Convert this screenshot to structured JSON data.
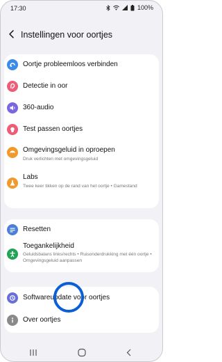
{
  "status": {
    "time": "17:30",
    "battery": "100%"
  },
  "header": {
    "title": "Instellingen voor oortjes"
  },
  "group1": [
    {
      "label": "Oortje probleemloos verbinden",
      "icon": "link-icon",
      "color": "#3d8be8"
    },
    {
      "label": "Detectie in oor",
      "icon": "ear-icon",
      "color": "#ee5d78"
    },
    {
      "label": "360-audio",
      "icon": "speaker-icon",
      "color": "#7a65e2"
    },
    {
      "label": "Test passen oortjes",
      "icon": "earbud-fit-icon",
      "color": "#ee5d78"
    },
    {
      "label": "Omgevingsgeluid in oproepen",
      "sub": "Druk verlichten met omgevingsgeluid",
      "icon": "ambient-sound-icon",
      "color": "#f09a2e"
    },
    {
      "label": "Labs",
      "sub": "Twee keer tikken op de rand van het oortje • Gamestand",
      "icon": "flask-icon",
      "color": "#f09a2e"
    }
  ],
  "group2": [
    {
      "label": "Resetten",
      "icon": "reset-icon",
      "color": "#4c7fd8"
    },
    {
      "label": "Toegankelijkheid",
      "sub": "Geluidsbalans links/rechts • Ruisonderdrukking met één oortje • Omgevingsgeluid aanpassen",
      "icon": "accessibility-icon",
      "color": "#23a455"
    }
  ],
  "group3": [
    {
      "label": "Softwareupdate voor oortjes",
      "icon": "software-update-icon",
      "color": "#6a6fd8"
    },
    {
      "label": "Over oortjes",
      "icon": "info-icon",
      "color": "#8a8a8a"
    }
  ],
  "colors": {
    "accent": "#0a5fd6",
    "background": "#f2f2f6"
  }
}
